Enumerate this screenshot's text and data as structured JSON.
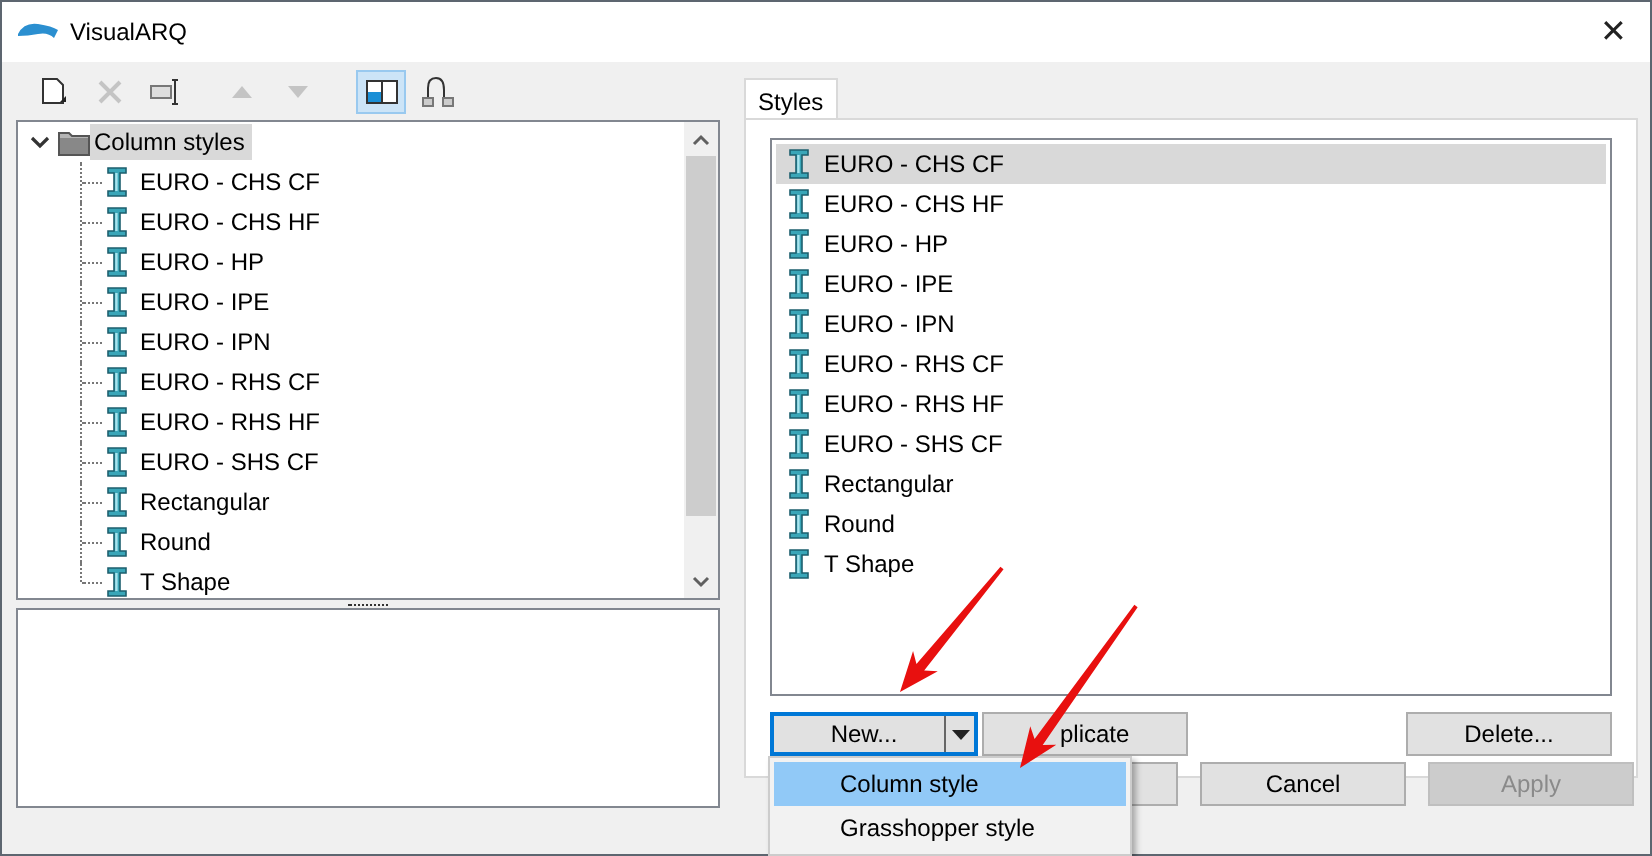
{
  "window": {
    "title": "VisualARQ",
    "close": "✕"
  },
  "toolbar": [
    {
      "kind": "new",
      "disabled": false,
      "selected": false
    },
    {
      "kind": "delete",
      "disabled": true,
      "selected": false
    },
    {
      "kind": "rename",
      "disabled": false,
      "selected": false
    },
    {
      "kind": "up",
      "disabled": true,
      "selected": false
    },
    {
      "kind": "down",
      "disabled": true,
      "selected": false
    },
    {
      "kind": "view",
      "disabled": false,
      "selected": true
    },
    {
      "kind": "profile",
      "disabled": false,
      "selected": false
    }
  ],
  "tree": {
    "label": "Column styles",
    "expanded": true,
    "selected": true,
    "children": [
      {
        "label": "EURO - CHS CF"
      },
      {
        "label": "EURO - CHS HF"
      },
      {
        "label": "EURO - HP"
      },
      {
        "label": "EURO - IPE"
      },
      {
        "label": "EURO - IPN"
      },
      {
        "label": "EURO - RHS CF"
      },
      {
        "label": "EURO - RHS HF"
      },
      {
        "label": "EURO - SHS CF"
      },
      {
        "label": "Rectangular"
      },
      {
        "label": "Round"
      },
      {
        "label": "T Shape"
      }
    ]
  },
  "tabs": [
    {
      "label": "Styles",
      "selected": true
    }
  ],
  "styles_list": [
    {
      "label": "EURO - CHS CF",
      "selected": true
    },
    {
      "label": "EURO - CHS HF",
      "selected": false
    },
    {
      "label": "EURO - HP",
      "selected": false
    },
    {
      "label": "EURO - IPE",
      "selected": false
    },
    {
      "label": "EURO - IPN",
      "selected": false
    },
    {
      "label": "EURO - RHS CF",
      "selected": false
    },
    {
      "label": "EURO - RHS HF",
      "selected": false
    },
    {
      "label": "EURO - SHS CF",
      "selected": false
    },
    {
      "label": "Rectangular",
      "selected": false
    },
    {
      "label": "Round",
      "selected": false
    },
    {
      "label": "T Shape",
      "selected": false
    }
  ],
  "list_buttons": [
    {
      "label": "New...",
      "kind": "split"
    },
    {
      "label": "plicate",
      "kind": "plain"
    },
    {
      "label": "Delete...",
      "kind": "plain"
    }
  ],
  "dropdown_menu": [
    {
      "label": "Column style",
      "selected": true
    },
    {
      "label": "Grasshopper style",
      "selected": false
    }
  ],
  "dialog_buttons": [
    {
      "label": "Cancel",
      "disabled": false
    },
    {
      "label": "Apply",
      "disabled": true
    }
  ],
  "annotations": [
    {
      "kind": "arrow"
    },
    {
      "kind": "arrow"
    }
  ]
}
